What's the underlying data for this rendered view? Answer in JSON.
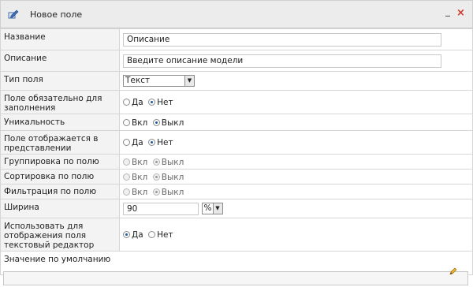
{
  "window": {
    "title": "Новое поле",
    "icon": "edit-field-icon",
    "minimize_label": "_",
    "close_label": "×",
    "colors": {
      "titlebar_bg": "#ececec",
      "close": "#d2332b",
      "label_bg": "#f3f3f3",
      "radio_selected": "#1e55a5"
    }
  },
  "fields": {
    "name": {
      "label": "Название",
      "value": "Описание"
    },
    "description": {
      "label": "Описание",
      "value": "Введите описание модели"
    },
    "field_type": {
      "label": "Тип поля",
      "value": "Текст"
    },
    "required": {
      "label": "Поле обязательно для заполнения",
      "options": [
        "Да",
        "Нет"
      ],
      "selected": "Нет"
    },
    "unique": {
      "label": "Уникальность",
      "options": [
        "Вкл",
        "Выкл"
      ],
      "selected": "Выкл"
    },
    "visible": {
      "label": "Поле отображается в представлении",
      "options": [
        "Да",
        "Нет"
      ],
      "selected": "Нет"
    },
    "grouping": {
      "label": "Группировка по полю",
      "options": [
        "Вкл",
        "Выкл"
      ],
      "selected": "Выкл",
      "disabled": true
    },
    "sorting": {
      "label": "Сортировка по полю",
      "options": [
        "Вкл",
        "Выкл"
      ],
      "selected": "Выкл",
      "disabled": true
    },
    "filtering": {
      "label": "Фильтрация по полю",
      "options": [
        "Вкл",
        "Выкл"
      ],
      "selected": "Выкл",
      "disabled": true
    },
    "width": {
      "label": "Ширина",
      "value": "90",
      "unit": "%"
    },
    "text_editor": {
      "label": "Использовать для отображения поля текстовый редактор",
      "options": [
        "Да",
        "Нет"
      ],
      "selected": "Да"
    },
    "default_value": {
      "label": "Значение по умолчанию",
      "value": "",
      "edit_icon": "pencil-icon"
    }
  }
}
